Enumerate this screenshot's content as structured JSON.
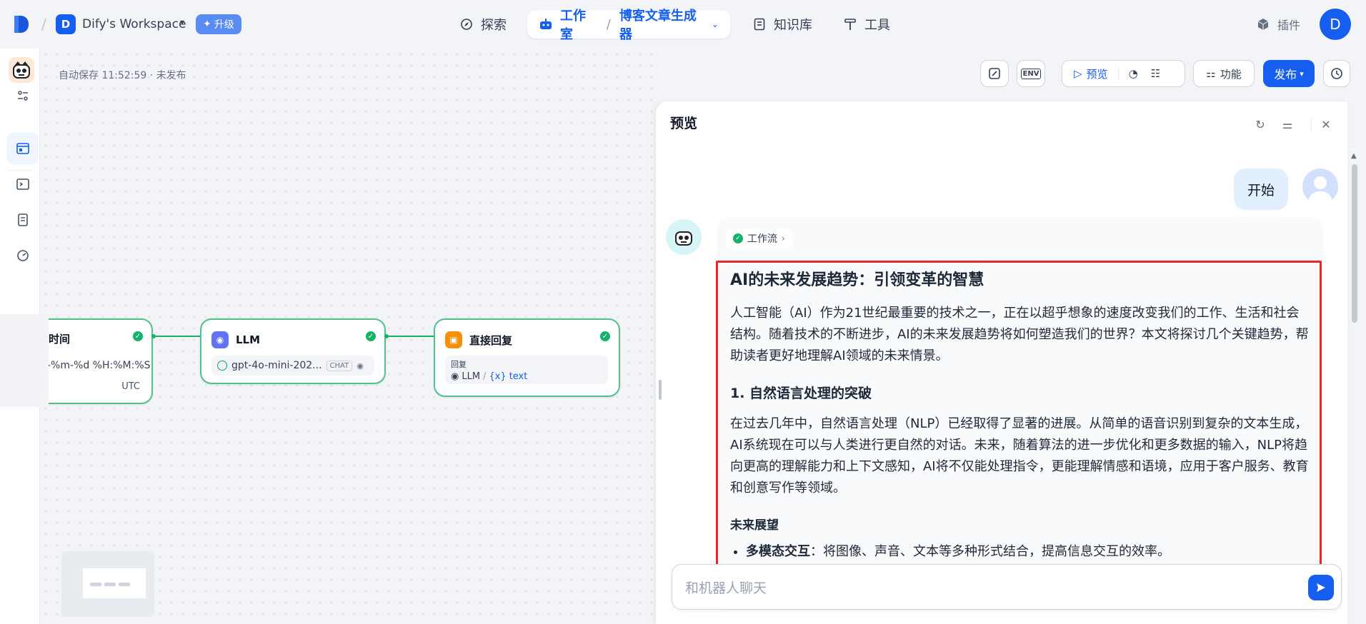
{
  "header": {
    "workspace_initial": "D",
    "workspace_name": "Dify's Workspace",
    "upgrade_label": "升级",
    "nav": {
      "explore": "探索",
      "studio": "工作室",
      "app_name": "博客文章生成器",
      "knowledge": "知识库",
      "tools": "工具",
      "plugins": "插件"
    },
    "user_initial": "D"
  },
  "editor": {
    "autosave": "自动保存 11:52:59 · 未发布",
    "toolbar": {
      "env_label": "ENV",
      "preview_label": "预览",
      "features_label": "功能",
      "publish_label": "发布"
    }
  },
  "nodes": {
    "time_node": {
      "title": "时间",
      "format": "-%m-%d %H:%M:%S",
      "timezone": "UTC"
    },
    "llm_node": {
      "title": "LLM",
      "model": "gpt-4o-mini-202...",
      "mode": "CHAT"
    },
    "answer_node": {
      "title": "直接回复",
      "reply_label": "回复",
      "ref_node": "LLM",
      "ref_var": "text"
    }
  },
  "preview": {
    "title": "预览",
    "user_message": "开始",
    "workflow_chip": "工作流",
    "article": {
      "title": "AI的未来发展趋势：引领变革的智慧",
      "intro": "人工智能（AI）作为21世纪最重要的技术之一，正在以超乎想象的速度改变我们的工作、生活和社会结构。随着技术的不断进步，AI的未来发展趋势将如何塑造我们的世界？本文将探讨几个关键趋势，帮助读者更好地理解AI领域的未来情景。",
      "section1_title": "1. 自然语言处理的突破",
      "section1_body": "在过去几年中，自然语言处理（NLP）已经取得了显著的进展。从简单的语音识别到复杂的文本生成，AI系统现在可以与人类进行更自然的对话。未来，随着算法的进一步优化和更多数据的输入，NLP将趋向更高的理解能力和上下文感知，AI将不仅能处理指令，更能理解情感和语境，应用于客户服务、教育和创意写作等领域。",
      "outlook_title": "未来展望",
      "bullet1_bold": "多模态交互",
      "bullet1_text": "：将图像、声音、文本等多种形式结合，提高信息交互的效率。"
    },
    "input_placeholder": "和机器人聊天"
  }
}
